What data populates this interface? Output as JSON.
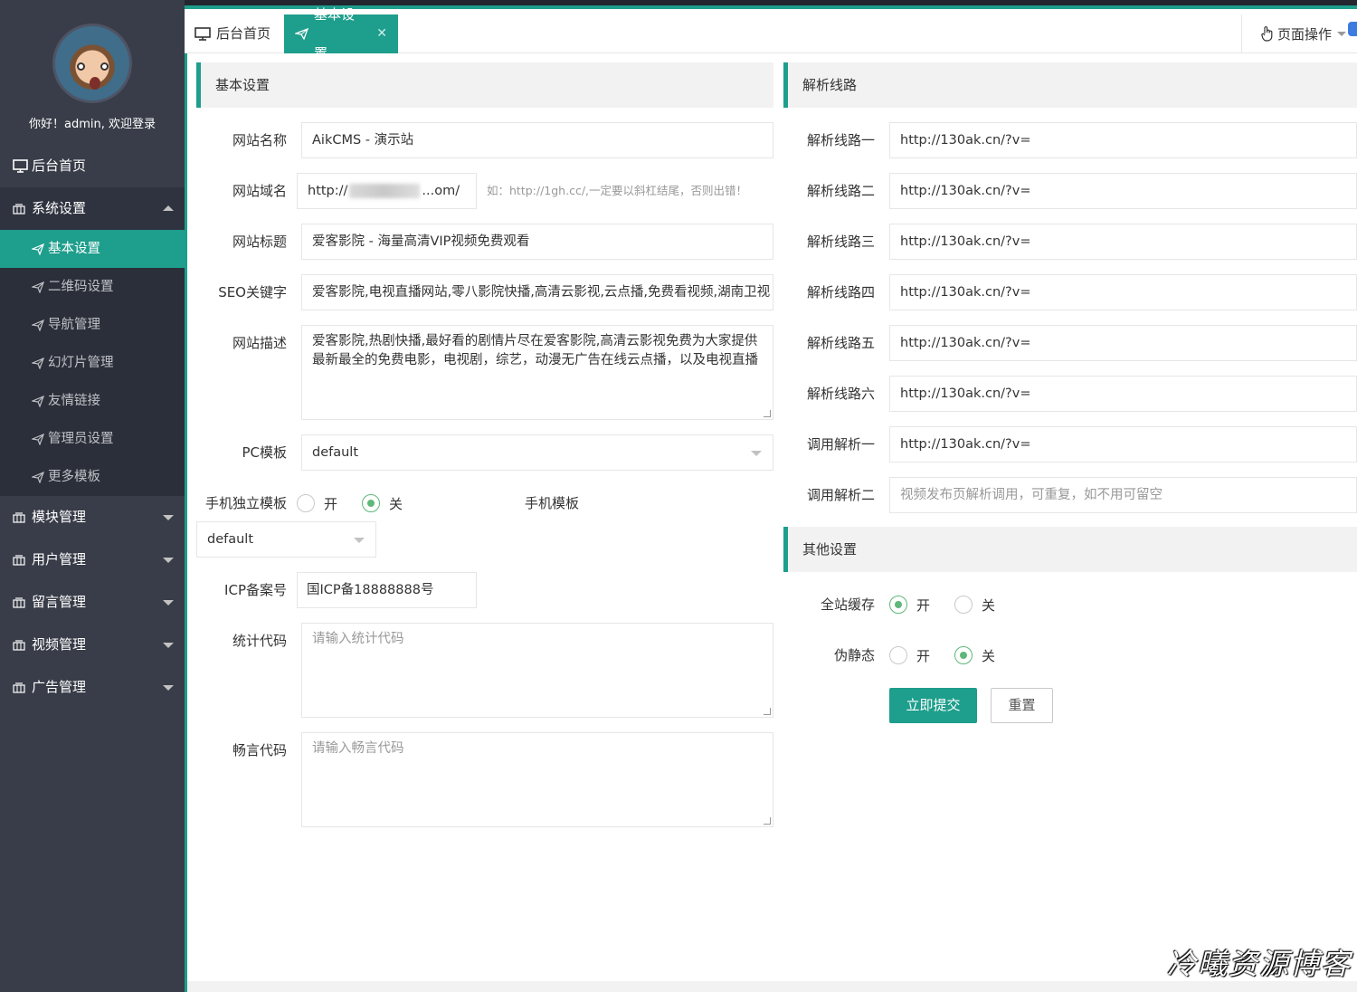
{
  "colors": {
    "sidebar": "#393d49",
    "accent": "#1e9e8c",
    "radio": "#5fb878"
  },
  "sidebar": {
    "welcome": "你好！admin, 欢迎登录",
    "home": "后台首页",
    "system_settings": "系统设置",
    "sub_items": [
      "基本设置",
      "二维码设置",
      "导航管理",
      "幻灯片管理",
      "友情链接",
      "管理员设置",
      "更多模板"
    ],
    "groups": [
      "模块管理",
      "用户管理",
      "留言管理",
      "视频管理",
      "广告管理"
    ]
  },
  "tabs": {
    "home": "后台首页",
    "active": "基本设置",
    "close": "✕",
    "page_ops": "页面操作"
  },
  "basic": {
    "header": "基本设置",
    "site_name_label": "网站名称",
    "site_name": "AikCMS - 演示站",
    "domain_label": "网站域名",
    "domain_prefix": "http://",
    "domain_suffix": "...om/",
    "domain_hint": "如：http://1gh.cc/,一定要以斜杠结尾，否则出错！",
    "title_label": "网站标题",
    "title": "爱客影院 - 海量高清VIP视频免费观看",
    "seo_label": "SEO关键字",
    "seo": "爱客影院,电视直播网站,零八影院快播,高清云影视,云点播,免费看视频,湖南卫视",
    "desc_label": "网站描述",
    "desc": "爱客影院,热剧快播,最好看的剧情片尽在爱客影院,高清云影视免费为大家提供最新最全的免费电影，电视剧，综艺，动漫无广告在线云点播，以及电视直播",
    "pc_tpl_label": "PC模板",
    "pc_tpl": "default",
    "mobile_tpl_label": "手机独立模板",
    "on": "开",
    "off": "关",
    "mobile_tpl_text": "手机模板",
    "mobile_tpl": "default",
    "icp_label": "ICP备案号",
    "icp": "国ICP备18888888号",
    "stats_label": "统计代码",
    "stats_placeholder": "请输入统计代码",
    "chat_label": "畅言代码",
    "chat_placeholder": "请输入畅言代码"
  },
  "parse": {
    "header": "解析线路",
    "rows": [
      {
        "label": "解析线路一",
        "value": "http://130ak.cn/?v="
      },
      {
        "label": "解析线路二",
        "value": "http://130ak.cn/?v="
      },
      {
        "label": "解析线路三",
        "value": "http://130ak.cn/?v="
      },
      {
        "label": "解析线路四",
        "value": "http://130ak.cn/?v="
      },
      {
        "label": "解析线路五",
        "value": "http://130ak.cn/?v="
      },
      {
        "label": "解析线路六",
        "value": "http://130ak.cn/?v="
      },
      {
        "label": "调用解析一",
        "value": "http://130ak.cn/?v="
      }
    ],
    "call2_label": "调用解析二",
    "call2_placeholder": "视频发布页解析调用，可重复，如不用可留空"
  },
  "other": {
    "header": "其他设置",
    "cache_label": "全站缓存",
    "static_label": "伪静态",
    "on": "开",
    "off": "关",
    "submit": "立即提交",
    "reset": "重置"
  },
  "watermark": "冷曦资源博客"
}
